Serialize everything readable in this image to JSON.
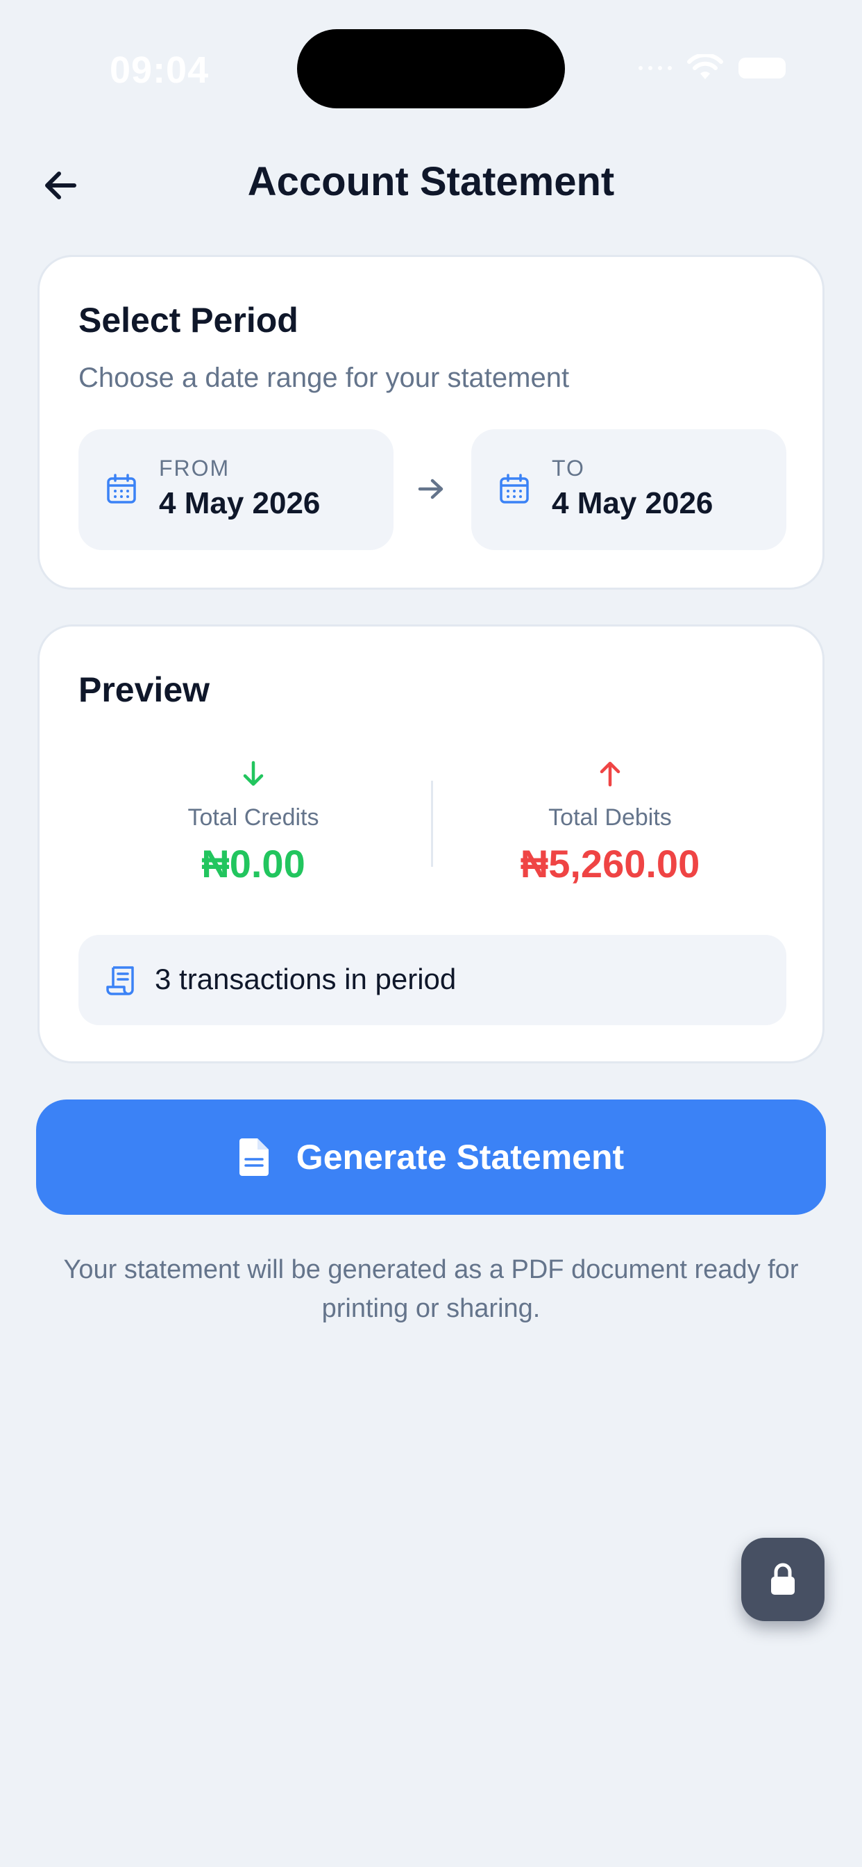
{
  "status_bar": {
    "time": "09:04"
  },
  "header": {
    "title": "Account Statement",
    "back_icon": "arrow-left-icon"
  },
  "period_card": {
    "title": "Select Period",
    "subtitle": "Choose a date range for your statement",
    "from": {
      "label": "FROM",
      "value": "4 May 2026"
    },
    "to": {
      "label": "TO",
      "value": "4 May 2026"
    }
  },
  "preview_card": {
    "title": "Preview",
    "credits": {
      "label": "Total Credits",
      "value": "₦0.00",
      "color": "#22c55e"
    },
    "debits": {
      "label": "Total Debits",
      "value": "₦5,260.00",
      "color": "#ef4444"
    },
    "transactions_text": "3 transactions in period"
  },
  "generate_button": {
    "label": "Generate Statement",
    "color": "#3b82f6"
  },
  "footnote": "Your statement will be generated as a PDF document ready for printing or sharing.",
  "colors": {
    "background": "#eef2f7",
    "accent": "#3b82f6",
    "credit": "#22c55e",
    "debit": "#ef4444"
  }
}
